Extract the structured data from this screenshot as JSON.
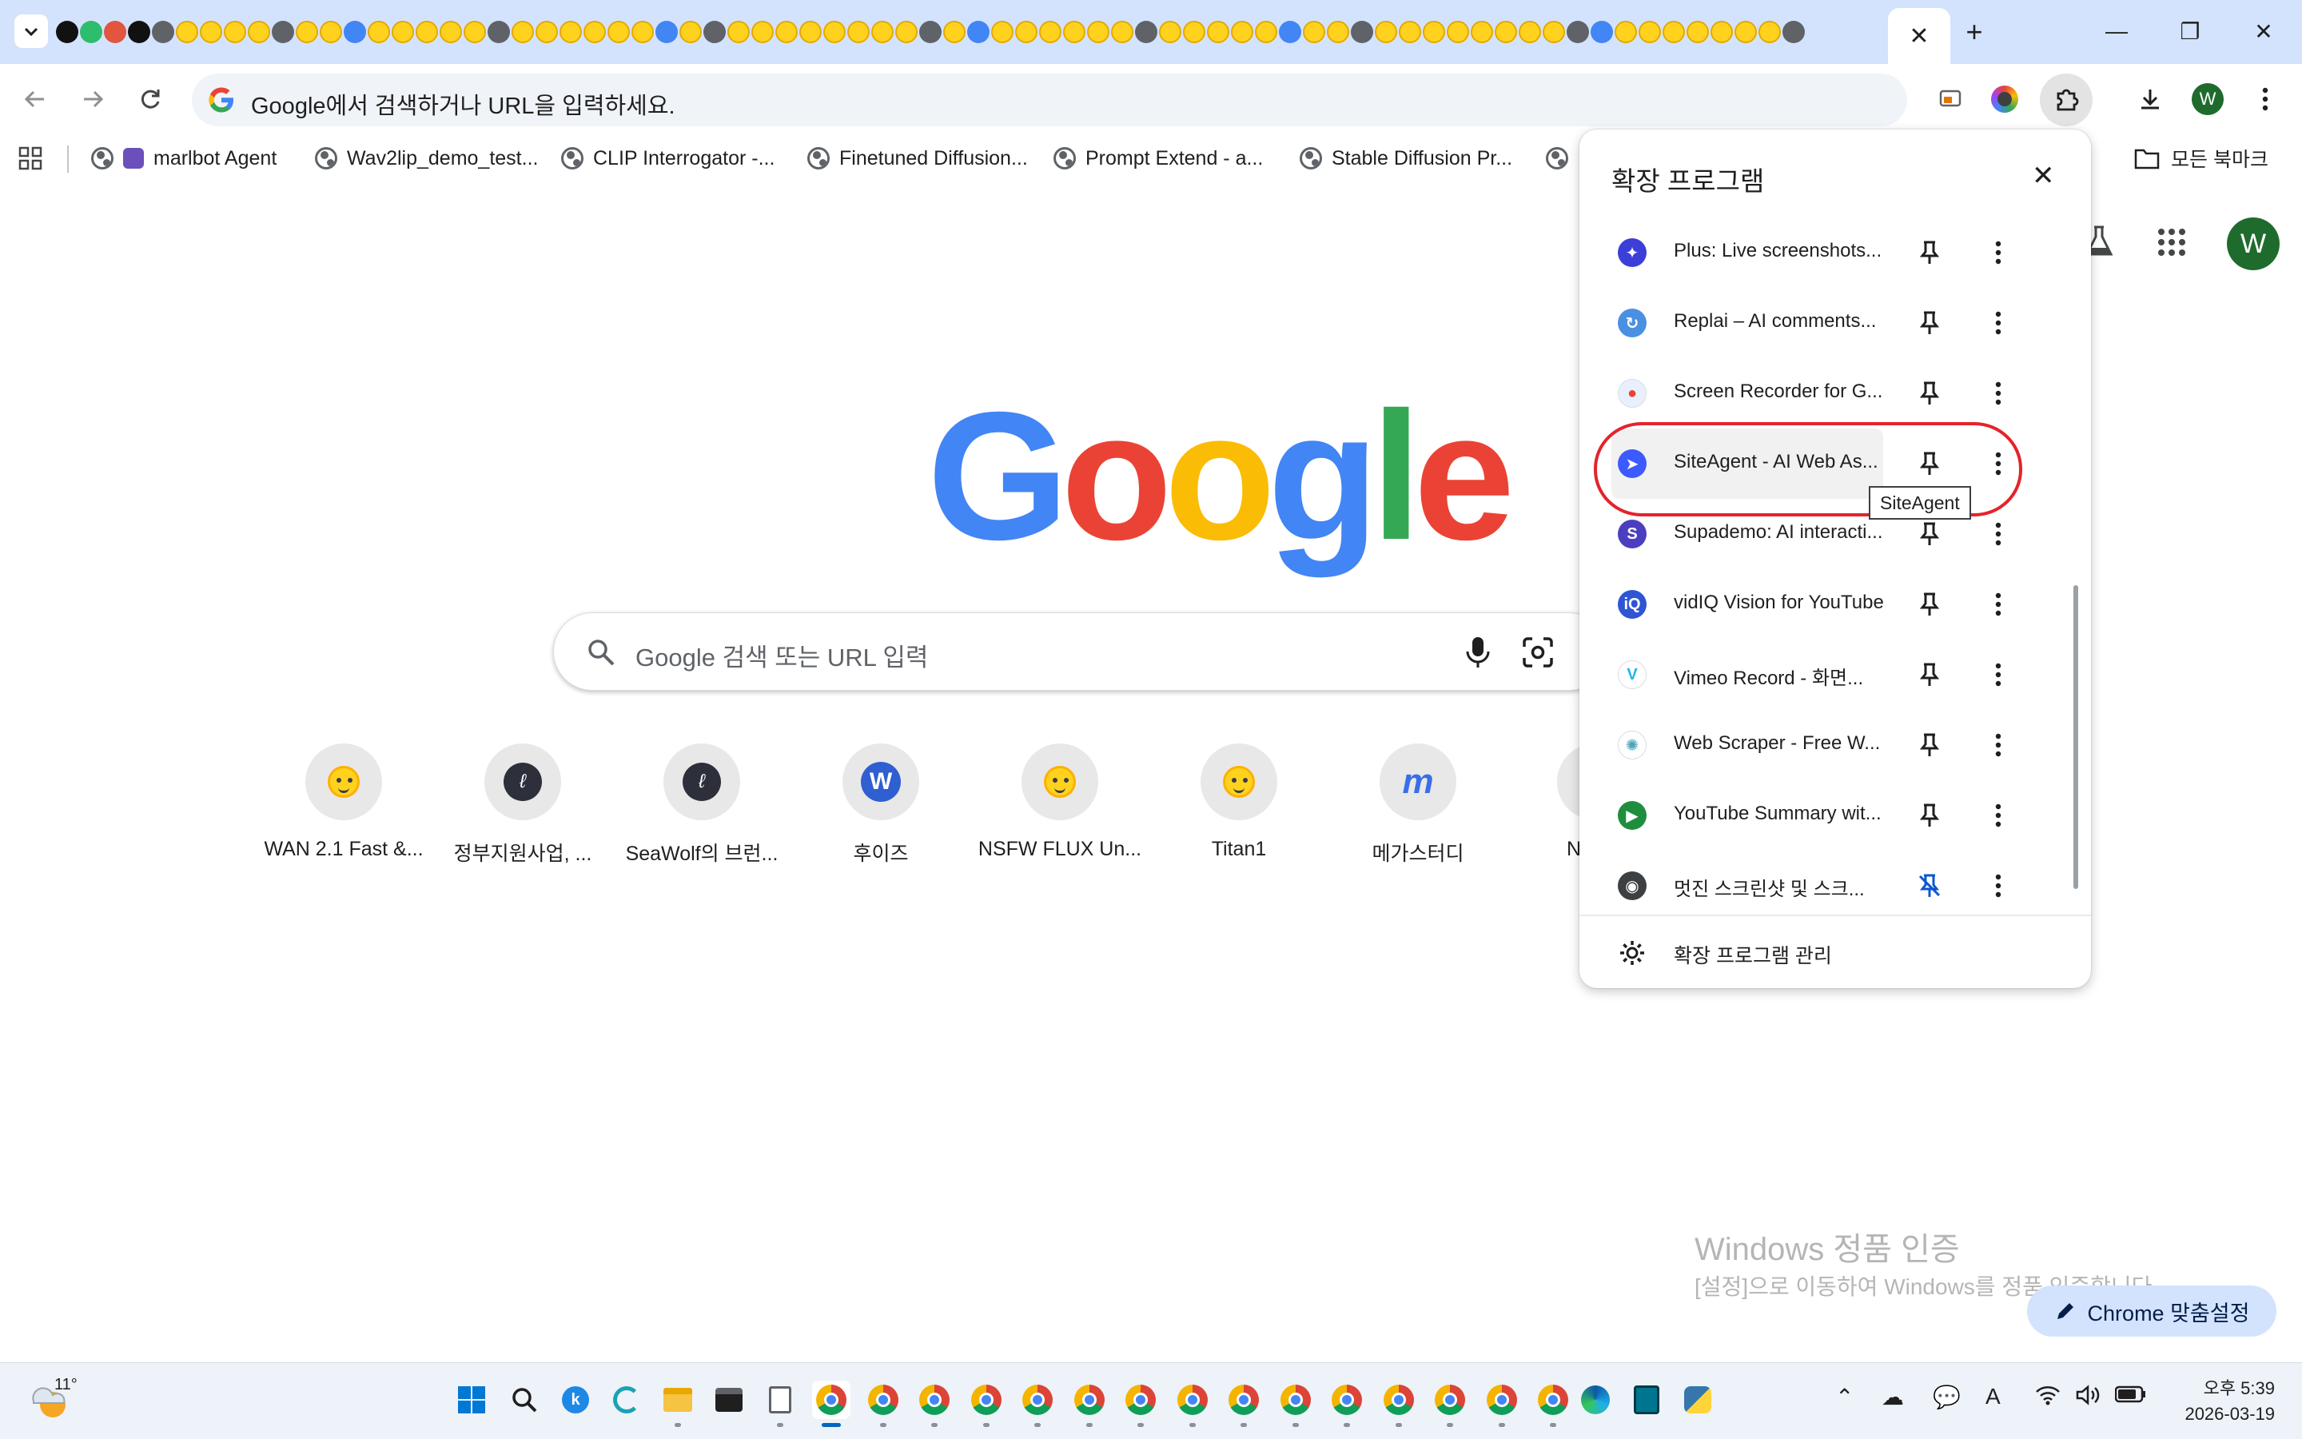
{
  "browser": {
    "active_tab_close": "✕",
    "new_tab": "+",
    "window_controls": {
      "minimize": "—",
      "maximize": "❐",
      "close": "✕"
    }
  },
  "toolbar": {
    "omnibox_placeholder": "Google에서 검색하거나 URL을 입력하세요.",
    "profile_initial": "W"
  },
  "bookmarks": {
    "items": [
      {
        "label": "marlbot Agent"
      },
      {
        "label": "Wav2lip_demo_test..."
      },
      {
        "label": "CLIP Interrogator -..."
      },
      {
        "label": "Finetuned Diffusion..."
      },
      {
        "label": "Prompt Extend - a..."
      },
      {
        "label": "Stable Diffusion Pr..."
      }
    ],
    "all_bookmarks": "모든 북마크"
  },
  "ntp": {
    "logo": {
      "letters": [
        "G",
        "o",
        "o",
        "g",
        "l",
        "e"
      ],
      "colors": [
        "#4285f4",
        "#ea4335",
        "#fbbc05",
        "#4285f4",
        "#34a853",
        "#ea4335"
      ]
    },
    "search_placeholder": "Google 검색 또는 URL 입력",
    "profile_initial": "W",
    "shortcuts": [
      {
        "label": "WAN 2.1 Fast &...",
        "icon": "huggingface-icon"
      },
      {
        "label": "정부지원사업, ...",
        "icon": "seawolf-icon"
      },
      {
        "label": "SeaWolf의 브런...",
        "icon": "seawolf-icon"
      },
      {
        "label": "후이즈",
        "icon": "w-logo-icon"
      },
      {
        "label": "NSFW FLUX Un...",
        "icon": "huggingface-icon"
      },
      {
        "label": "Titan1",
        "icon": "huggingface-icon"
      },
      {
        "label": "메가스터디",
        "icon": "megastudy-icon"
      },
      {
        "label": "N",
        "icon": "huggingface-icon"
      }
    ],
    "customize_label": "Chrome 맞춤설정"
  },
  "watermark": {
    "line1": "Windows 정품 인증",
    "line2": "[설정]으로 이동하여 Windows를 정품 인증합니다."
  },
  "extensions_popup": {
    "title": "확장 프로그램",
    "items": [
      {
        "name": "Plus: Live screenshots...",
        "color": "#3b3fd8",
        "glyph": "✦",
        "pinned": false
      },
      {
        "name": "Replai – AI comments...",
        "color": "#4a90e2",
        "glyph": "↻",
        "pinned": false
      },
      {
        "name": "Screen Recorder for G...",
        "color": "#e8f0fe",
        "glyph": "●",
        "pinned": false
      },
      {
        "name": "SiteAgent - AI Web As...",
        "color": "#3d5afe",
        "glyph": "➤",
        "pinned": false
      },
      {
        "name": "Supademo: AI interacti...",
        "color": "#4b3fc0",
        "glyph": "S",
        "pinned": false
      },
      {
        "name": "vidIQ Vision for YouTube",
        "color": "#2f55d4",
        "glyph": "iQ",
        "pinned": false
      },
      {
        "name": "Vimeo Record - 화면...",
        "color": "#ffffff",
        "glyph": "V",
        "pinned": false
      },
      {
        "name": "Web Scraper - Free W...",
        "color": "#ffffff",
        "glyph": "✺",
        "pinned": false
      },
      {
        "name": "YouTube Summary wit...",
        "color": "#1e8e3e",
        "glyph": "▶",
        "pinned": false
      },
      {
        "name": "멋진 스크린샷 및 스크...",
        "color": "#3c4043",
        "glyph": "◉",
        "pinned": true
      }
    ],
    "manage_label": "확장 프로그램 관리",
    "tooltip": "SiteAgent"
  },
  "taskbar": {
    "weather_temp": "11°",
    "time": "오후 5:39",
    "date": "2026-03-19"
  }
}
